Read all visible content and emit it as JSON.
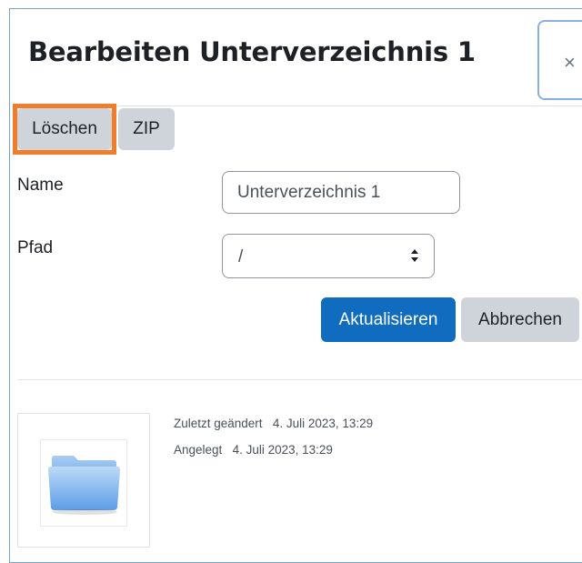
{
  "dialog": {
    "title": "Bearbeiten Unterverzeichnis 1",
    "close_symbol": "×"
  },
  "actions": {
    "delete_label": "Löschen",
    "zip_label": "ZIP"
  },
  "form": {
    "name_label": "Name",
    "name_value": "Unterverzeichnis 1",
    "path_label": "Pfad",
    "path_value": "/"
  },
  "buttons": {
    "update_label": "Aktualisieren",
    "cancel_label": "Abbrechen"
  },
  "info": {
    "modified_label": "Zuletzt geändert",
    "modified_value": "4. Juli 2023, 13:29",
    "created_label": "Angelegt",
    "created_value": "4. Juli 2023, 13:29",
    "thumbnail_icon": "folder-icon"
  },
  "colors": {
    "primary": "#0f6cbf",
    "secondary": "#ced4da",
    "focus": "#f07d2a"
  }
}
